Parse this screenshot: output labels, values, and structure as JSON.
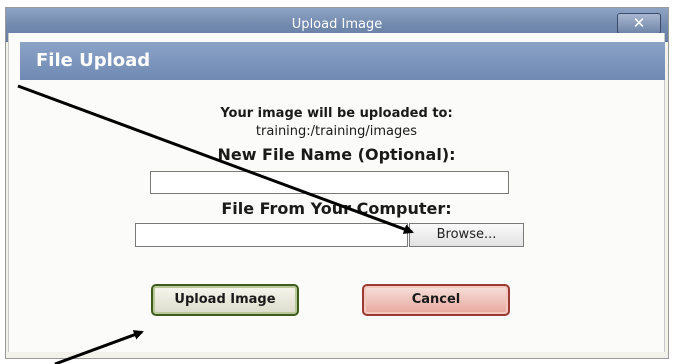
{
  "window": {
    "title": "Upload Image",
    "close_label": "✕"
  },
  "section": {
    "title": "File Upload"
  },
  "info": {
    "destination_label": "Your image will be uploaded to:",
    "destination_path": "training:/training/images"
  },
  "fields": {
    "new_file_name_label": "New File Name (Optional):",
    "new_file_name_value": "",
    "file_from_computer_label": "File From Your Computer:",
    "file_path_value": "",
    "browse_label": "Browse..."
  },
  "actions": {
    "upload_label": "Upload Image",
    "cancel_label": "Cancel"
  },
  "colors": {
    "title_bar": "#7188ad",
    "section_header": "#7b94bd",
    "upload_border": "#3f5b1e",
    "cancel_fill": "#e8a79c",
    "annotation_arrow": "#000000"
  }
}
